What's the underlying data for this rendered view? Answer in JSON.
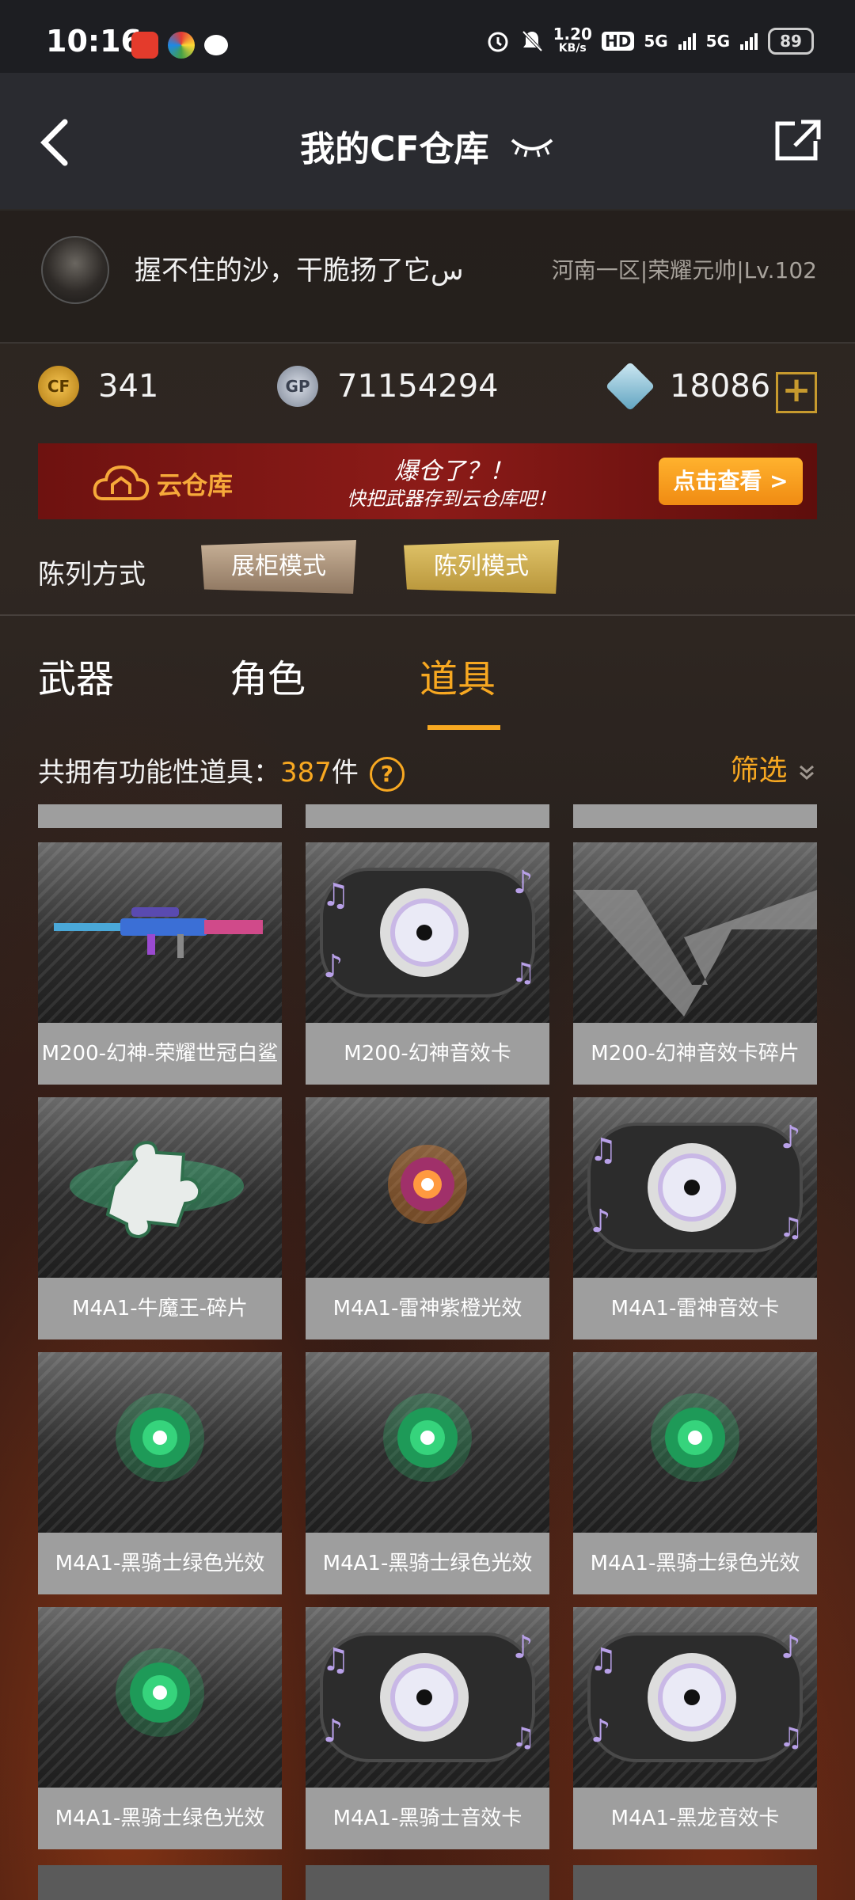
{
  "status_bar": {
    "time": "10:16",
    "net_speed": "1.20",
    "net_unit": "KB/s",
    "hd": "HD",
    "sim1": "5G",
    "sim2": "5G",
    "battery": "89"
  },
  "header": {
    "title": "我的CF仓库",
    "back_icon": "chevron-left-icon",
    "share_icon": "external-link-icon"
  },
  "profile": {
    "username": "握不住的沙，干脆扬了它س",
    "server_info": "河南一区|荣耀元帅|Lv.102"
  },
  "currencies": [
    {
      "icon": "cf-coin-icon",
      "value": "341"
    },
    {
      "icon": "gp-coin-icon",
      "value": "71154294"
    },
    {
      "icon": "diamond-icon",
      "value": "18086"
    }
  ],
  "banner": {
    "title": "云仓库",
    "slogan_main": "爆仓了？！",
    "slogan_sub": "快把武器存到云仓库吧！",
    "button": "点击查看 >"
  },
  "display_mode": {
    "label": "陈列方式",
    "options": [
      "展柜模式",
      "陈列模式"
    ],
    "selected": "陈列模式"
  },
  "tabs": [
    {
      "label": "武器",
      "active": false
    },
    {
      "label": "角色",
      "active": false
    },
    {
      "label": "道具",
      "active": true
    }
  ],
  "summary": {
    "label": "共拥有功能性道具：",
    "count": "387",
    "unit": "件",
    "filter": "筛选"
  },
  "items": [
    {
      "name": "M200-幻神-荣耀世冠白鲨",
      "icon": "sniper-rifle-icon"
    },
    {
      "name": "M200-幻神音效卡",
      "icon": "sound-card-icon"
    },
    {
      "name": "M200-幻神音效卡碎片",
      "icon": "cf-logo-icon"
    },
    {
      "name": "M4A1-牛魔王-碎片",
      "icon": "puzzle-piece-icon"
    },
    {
      "name": "M4A1-雷神紫橙光效",
      "icon": "purple-orange-glow-icon"
    },
    {
      "name": "M4A1-雷神音效卡",
      "icon": "sound-card-icon"
    },
    {
      "name": "M4A1-黑骑士绿色光效",
      "icon": "green-glow-icon"
    },
    {
      "name": "M4A1-黑骑士绿色光效",
      "icon": "green-glow-icon"
    },
    {
      "name": "M4A1-黑骑士绿色光效",
      "icon": "green-glow-icon"
    },
    {
      "name": "M4A1-黑骑士绿色光效",
      "icon": "green-glow-icon"
    },
    {
      "name": "M4A1-黑骑士音效卡",
      "icon": "sound-card-icon"
    },
    {
      "name": "M4A1-黑龙音效卡",
      "icon": "sound-card-icon"
    }
  ],
  "colors": {
    "accent": "#f7a821",
    "banner_red": "#8c1b18",
    "card_label_bg": "#9e9e9e"
  }
}
